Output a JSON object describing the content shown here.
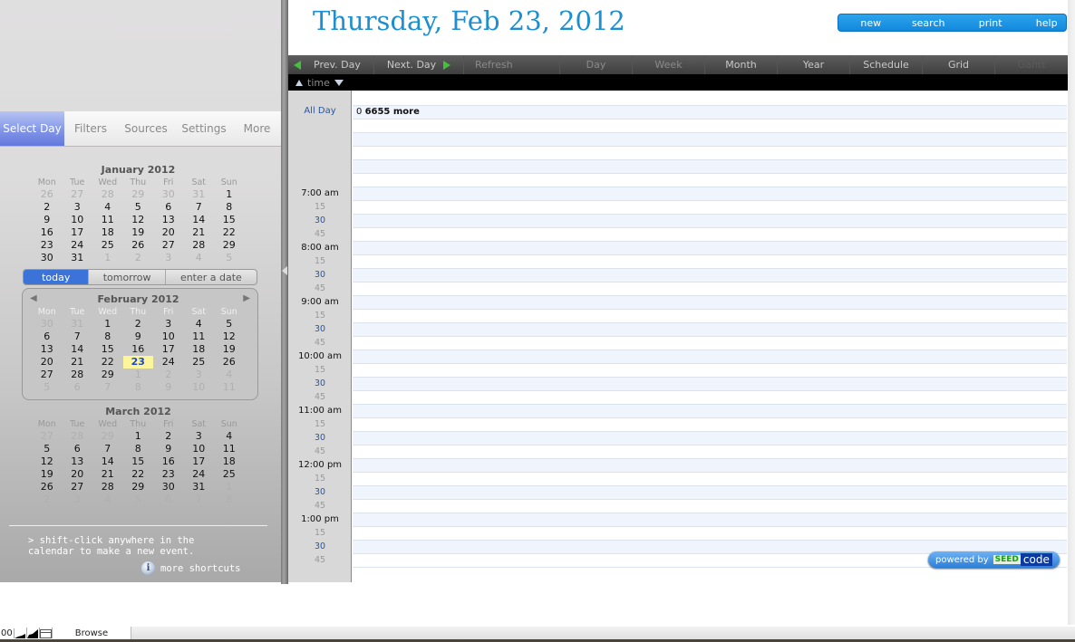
{
  "sidebar": {
    "tabs": [
      {
        "label": "Select Day",
        "active": true
      },
      {
        "label": "Filters",
        "active": false
      },
      {
        "label": "Sources",
        "active": false
      },
      {
        "label": "Settings",
        "active": false
      },
      {
        "label": "More",
        "active": false
      }
    ],
    "weekdays": [
      "Mon",
      "Tue",
      "Wed",
      "Thu",
      "Fri",
      "Sat",
      "Sun"
    ],
    "months": [
      {
        "title": "January 2012",
        "days": [
          {
            "d": "26",
            "o": true
          },
          {
            "d": "27",
            "o": true
          },
          {
            "d": "28",
            "o": true
          },
          {
            "d": "29",
            "o": true
          },
          {
            "d": "30",
            "o": true
          },
          {
            "d": "31",
            "o": true
          },
          {
            "d": "1"
          },
          {
            "d": "2"
          },
          {
            "d": "3"
          },
          {
            "d": "4"
          },
          {
            "d": "5"
          },
          {
            "d": "6"
          },
          {
            "d": "7"
          },
          {
            "d": "8"
          },
          {
            "d": "9"
          },
          {
            "d": "10"
          },
          {
            "d": "11"
          },
          {
            "d": "12"
          },
          {
            "d": "13"
          },
          {
            "d": "14"
          },
          {
            "d": "15"
          },
          {
            "d": "16"
          },
          {
            "d": "17"
          },
          {
            "d": "18"
          },
          {
            "d": "19"
          },
          {
            "d": "20"
          },
          {
            "d": "21"
          },
          {
            "d": "22"
          },
          {
            "d": "23"
          },
          {
            "d": "24"
          },
          {
            "d": "25"
          },
          {
            "d": "26"
          },
          {
            "d": "27"
          },
          {
            "d": "28"
          },
          {
            "d": "29"
          },
          {
            "d": "30"
          },
          {
            "d": "31"
          },
          {
            "d": "1",
            "o": true
          },
          {
            "d": "2",
            "o": true
          },
          {
            "d": "3",
            "o": true
          },
          {
            "d": "4",
            "o": true
          },
          {
            "d": "5",
            "o": true
          }
        ]
      },
      {
        "title": "February 2012",
        "days": [
          {
            "d": "30",
            "o": true
          },
          {
            "d": "31",
            "o": true
          },
          {
            "d": "1"
          },
          {
            "d": "2"
          },
          {
            "d": "3"
          },
          {
            "d": "4"
          },
          {
            "d": "5"
          },
          {
            "d": "6"
          },
          {
            "d": "7"
          },
          {
            "d": "8"
          },
          {
            "d": "9"
          },
          {
            "d": "10"
          },
          {
            "d": "11"
          },
          {
            "d": "12"
          },
          {
            "d": "13"
          },
          {
            "d": "14"
          },
          {
            "d": "15"
          },
          {
            "d": "16"
          },
          {
            "d": "17"
          },
          {
            "d": "18"
          },
          {
            "d": "19"
          },
          {
            "d": "20"
          },
          {
            "d": "21"
          },
          {
            "d": "22"
          },
          {
            "d": "23",
            "sel": true
          },
          {
            "d": "24"
          },
          {
            "d": "25"
          },
          {
            "d": "26"
          },
          {
            "d": "27"
          },
          {
            "d": "28"
          },
          {
            "d": "29"
          },
          {
            "d": "1",
            "o": true
          },
          {
            "d": "2",
            "o": true
          },
          {
            "d": "3",
            "o": true
          },
          {
            "d": "4",
            "o": true
          },
          {
            "d": "5",
            "o": true
          },
          {
            "d": "6",
            "o": true
          },
          {
            "d": "7",
            "o": true
          },
          {
            "d": "8",
            "o": true
          },
          {
            "d": "9",
            "o": true
          },
          {
            "d": "10",
            "o": true
          },
          {
            "d": "11",
            "o": true
          }
        ]
      },
      {
        "title": "March 2012",
        "days": [
          {
            "d": "27",
            "o": true
          },
          {
            "d": "28",
            "o": true
          },
          {
            "d": "29",
            "o": true
          },
          {
            "d": "1"
          },
          {
            "d": "2"
          },
          {
            "d": "3"
          },
          {
            "d": "4"
          },
          {
            "d": "5"
          },
          {
            "d": "6"
          },
          {
            "d": "7"
          },
          {
            "d": "8"
          },
          {
            "d": "9"
          },
          {
            "d": "10"
          },
          {
            "d": "11"
          },
          {
            "d": "12"
          },
          {
            "d": "13"
          },
          {
            "d": "14"
          },
          {
            "d": "15"
          },
          {
            "d": "16"
          },
          {
            "d": "17"
          },
          {
            "d": "18"
          },
          {
            "d": "19"
          },
          {
            "d": "20"
          },
          {
            "d": "21"
          },
          {
            "d": "22"
          },
          {
            "d": "23"
          },
          {
            "d": "24"
          },
          {
            "d": "25"
          },
          {
            "d": "26"
          },
          {
            "d": "27"
          },
          {
            "d": "28"
          },
          {
            "d": "29"
          },
          {
            "d": "30"
          },
          {
            "d": "31"
          },
          {
            "d": "1",
            "o": true
          },
          {
            "d": "2",
            "o": true
          },
          {
            "d": "3",
            "o": true
          },
          {
            "d": "4",
            "o": true
          },
          {
            "d": "5",
            "o": true
          },
          {
            "d": "6",
            "o": true
          },
          {
            "d": "7",
            "o": true
          },
          {
            "d": "8",
            "o": true
          }
        ]
      }
    ],
    "quick_buttons": [
      "today",
      "tomorrow",
      "enter a date"
    ],
    "tip": "> shift-click anywhere in the\ncalendar to make a new event.",
    "shortcuts_label": "more shortcuts",
    "info_glyph": "i"
  },
  "header": {
    "date_title": "Thursday, Feb 23, 2012",
    "actions": [
      "new",
      "search",
      "print",
      "help"
    ]
  },
  "toolbar": {
    "prev": "Prev. Day",
    "next": "Next. Day",
    "refresh": "Refresh",
    "views": [
      "Day",
      "Week",
      "Month",
      "Year",
      "Schedule",
      "Grid",
      "Gantt"
    ],
    "time_label": "time"
  },
  "grid": {
    "all_day_label": "All Day",
    "all_day_count": "0",
    "all_day_more": "6655 more",
    "time_labels": [
      {
        "t": "7:00 am",
        "k": "hour"
      },
      {
        "t": "15",
        "k": "q15"
      },
      {
        "t": "30",
        "k": "q30"
      },
      {
        "t": "45",
        "k": "q45"
      },
      {
        "t": "8:00 am",
        "k": "hour"
      },
      {
        "t": "15",
        "k": "q15"
      },
      {
        "t": "30",
        "k": "q30"
      },
      {
        "t": "45",
        "k": "q45"
      },
      {
        "t": "9:00 am",
        "k": "hour"
      },
      {
        "t": "15",
        "k": "q15"
      },
      {
        "t": "30",
        "k": "q30"
      },
      {
        "t": "45",
        "k": "q45"
      },
      {
        "t": "10:00 am",
        "k": "hour"
      },
      {
        "t": "15",
        "k": "q15"
      },
      {
        "t": "30",
        "k": "q30"
      },
      {
        "t": "45",
        "k": "q45"
      },
      {
        "t": "11:00 am",
        "k": "hour"
      },
      {
        "t": "15",
        "k": "q15"
      },
      {
        "t": "30",
        "k": "q30"
      },
      {
        "t": "45",
        "k": "q45"
      },
      {
        "t": "12:00 pm",
        "k": "hour"
      },
      {
        "t": "15",
        "k": "q15"
      },
      {
        "t": "30",
        "k": "q30"
      },
      {
        "t": "45",
        "k": "q45"
      },
      {
        "t": "1:00 pm",
        "k": "hour"
      },
      {
        "t": "15",
        "k": "q15"
      },
      {
        "t": "30",
        "k": "q30"
      },
      {
        "t": "45",
        "k": "q45"
      }
    ]
  },
  "badge": {
    "powered_by": "powered by",
    "seed": "SEED",
    "code": "code"
  },
  "status_bar": {
    "zoom": "00",
    "mode": "Browse"
  }
}
